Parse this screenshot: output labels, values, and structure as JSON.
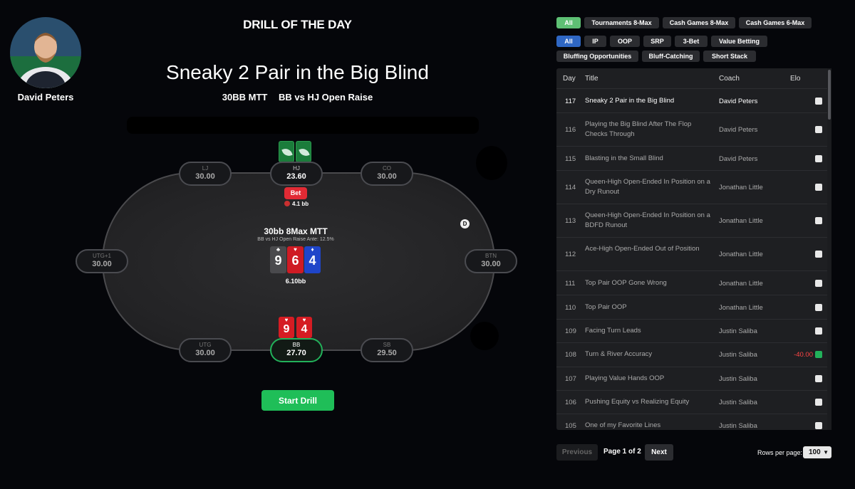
{
  "coach": {
    "name": "David Peters"
  },
  "header": {
    "drill_of_day": "DRILL OF THE DAY",
    "title": "Sneaky 2 Pair in the Big Blind",
    "subtitle_left": "30BB MTT",
    "subtitle_right": "BB vs HJ Open Raise"
  },
  "table": {
    "seats": [
      {
        "pos": "LJ",
        "stack": "30.00"
      },
      {
        "pos": "HJ",
        "stack": "23.60"
      },
      {
        "pos": "CO",
        "stack": "30.00"
      },
      {
        "pos": "UTG+1",
        "stack": "30.00"
      },
      {
        "pos": "BTN",
        "stack": "30.00"
      },
      {
        "pos": "UTG",
        "stack": "30.00"
      },
      {
        "pos": "BB",
        "stack": "27.70"
      },
      {
        "pos": "SB",
        "stack": "29.50"
      }
    ],
    "bet_label": "Bet",
    "bet_amount": "4.1 bb",
    "dealer": "D",
    "game_title": "30bb 8Max MTT",
    "game_sub": "BB vs HJ Open Raise Ante: 12.5%",
    "board": [
      {
        "rank": "9",
        "suit": "♣",
        "color": "#4a4a4d"
      },
      {
        "rank": "6",
        "suit": "♥",
        "color": "#cf1b24"
      },
      {
        "rank": "4",
        "suit": "♦",
        "color": "#1f45c9"
      }
    ],
    "pot": "6.10bb",
    "hero_cards": [
      {
        "rank": "9",
        "suit": "♥"
      },
      {
        "rank": "4",
        "suit": "♥"
      }
    ]
  },
  "start_button": "Start Drill",
  "filters": {
    "row1": [
      "All",
      "Tournaments 8-Max",
      "Cash Games 8-Max",
      "Cash Games 6-Max"
    ],
    "row2": [
      "All",
      "IP",
      "OOP",
      "SRP",
      "3-Bet",
      "Value Betting"
    ],
    "row3": [
      "Bluffing Opportunities",
      "Bluff-Catching",
      "Short Stack"
    ]
  },
  "list": {
    "headers": {
      "day": "Day",
      "title": "Title",
      "coach": "Coach",
      "elo": "Elo"
    },
    "rows": [
      {
        "day": "117",
        "title": "Sneaky 2 Pair in the Big Blind",
        "coach": "David Peters",
        "elo": ""
      },
      {
        "day": "116",
        "title": "Playing the Big Blind After The Flop Checks Through",
        "coach": "David Peters",
        "elo": ""
      },
      {
        "day": "115",
        "title": "Blasting in the Small Blind",
        "coach": "David Peters",
        "elo": ""
      },
      {
        "day": "114",
        "title": "Queen-High Open-Ended In Position on a Dry Runout",
        "coach": "Jonathan Little",
        "elo": ""
      },
      {
        "day": "113",
        "title": "Queen-High Open-Ended In Position on a BDFD Runout",
        "coach": "Jonathan Little",
        "elo": ""
      },
      {
        "day": "112",
        "title": "Ace-High Open-Ended Out of Position",
        "coach": "Jonathan Little",
        "elo": ""
      },
      {
        "day": "111",
        "title": "Top Pair OOP Gone Wrong",
        "coach": "Jonathan Little",
        "elo": ""
      },
      {
        "day": "110",
        "title": "Top Pair OOP",
        "coach": "Jonathan Little",
        "elo": ""
      },
      {
        "day": "109",
        "title": "Facing Turn Leads",
        "coach": "Justin Saliba",
        "elo": ""
      },
      {
        "day": "108",
        "title": "Turn & River Accuracy",
        "coach": "Justin Saliba",
        "elo": "-40.00"
      },
      {
        "day": "107",
        "title": "Playing Value Hands OOP",
        "coach": "Justin Saliba",
        "elo": ""
      },
      {
        "day": "106",
        "title": "Pushing Equity vs Realizing Equity",
        "coach": "Justin Saliba",
        "elo": ""
      },
      {
        "day": "105",
        "title": "One of my Favorite Lines",
        "coach": "Justin Saliba",
        "elo": ""
      }
    ]
  },
  "pagination": {
    "previous": "Previous",
    "page_info": "Page 1 of 2",
    "next": "Next",
    "rows_label": "Rows per page:",
    "rows_value": "100"
  }
}
